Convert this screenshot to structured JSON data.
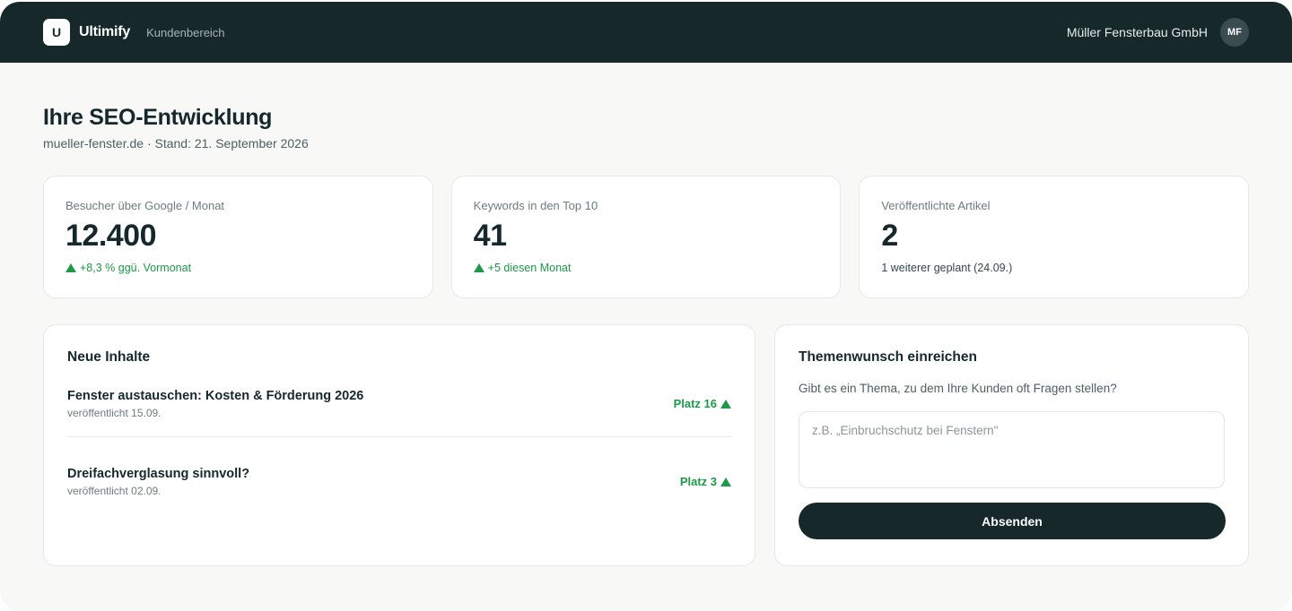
{
  "header": {
    "logo_letter": "U",
    "brand_name": "Ultimify",
    "section_label": "Kundenbereich",
    "company_name": "Müller Fensterbau GmbH",
    "avatar_initials": "MF"
  },
  "page": {
    "title": "Ihre SEO-Entwicklung",
    "subtitle": "mueller-fenster.de · Stand: 21. September 2026"
  },
  "stats": [
    {
      "label": "Besucher über Google / Monat",
      "value": "12.400",
      "delta": "+8,3 % ggü. Vormonat",
      "trend": "up"
    },
    {
      "label": "Keywords in den Top 10",
      "value": "41",
      "delta": "+5 diesen Monat",
      "trend": "up"
    },
    {
      "label": "Veröffentlichte Artikel",
      "value": "2",
      "note": "1 weiterer geplant (24.09.)"
    }
  ],
  "new_content": {
    "title": "Neue Inhalte",
    "items": [
      {
        "title": "Fenster austauschen: Kosten & Förderung 2026",
        "date": "veröffentlicht 15.09.",
        "rank": "Platz 16",
        "trend": "up"
      },
      {
        "title": "Dreifachverglasung sinnvoll?",
        "date": "veröffentlicht 02.09.",
        "rank": "Platz 3",
        "trend": "up"
      }
    ]
  },
  "topic_request": {
    "title": "Themenwunsch einreichen",
    "description": "Gibt es ein Thema, zu dem Ihre Kunden oft Fragen stellen?",
    "placeholder": "z.B. „Einbruchschutz bei Fenstern\"",
    "value": "",
    "submit_label": "Absenden"
  },
  "colors": {
    "header_bg": "#17282b",
    "page_bg": "#f8f8f6",
    "positive": "#1c9a47",
    "primary_button": "#17282b"
  }
}
